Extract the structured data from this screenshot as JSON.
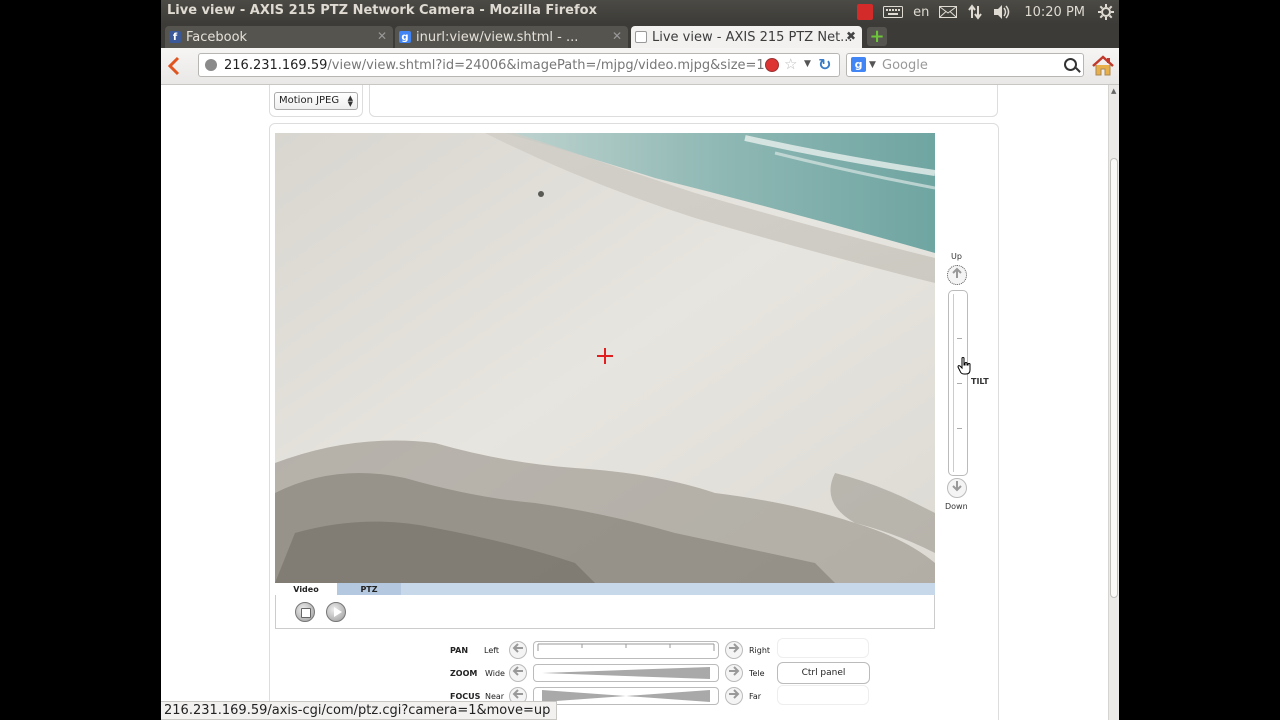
{
  "window": {
    "title": "Live view - AXIS 215 PTZ Network Camera - Mozilla Firefox"
  },
  "system_tray": {
    "keyboard_layout": "en",
    "clock": "10:20 PM"
  },
  "tabs": [
    {
      "label": "Facebook",
      "icon": "facebook-icon",
      "active": false
    },
    {
      "label": "inurl:view/view.shtml - ...",
      "icon": "google-icon",
      "active": false
    },
    {
      "label": "Live view - AXIS 215 PTZ Net...",
      "icon": "page-icon",
      "active": true
    }
  ],
  "navigation": {
    "url_host": "216.231.169.59",
    "url_path": "/view/view.shtml?id=24006&imagePath=/mjpg/video.mjpg&size=1",
    "search_placeholder": "Google"
  },
  "stream_format": {
    "selected": "Motion JPEG"
  },
  "view_tabs": [
    {
      "label": "Video",
      "active": true
    },
    {
      "label": "PTZ",
      "active": false
    }
  ],
  "tilt": {
    "up_label": "Up",
    "down_label": "Down",
    "axis_label": "TILT"
  },
  "ptz_rows": [
    {
      "name": "PAN",
      "left": "Left",
      "right": "Right"
    },
    {
      "name": "ZOOM",
      "left": "Wide",
      "right": "Tele"
    },
    {
      "name": "FOCUS",
      "left": "Near",
      "right": "Far"
    }
  ],
  "ctrl_panel_label": "Ctrl panel",
  "status_bar": "216.231.169.59/axis-cgi/com/ptz.cgi?camera=1&move=up",
  "colors": {
    "crosshair": "#e02020",
    "tab_bar_active": "#c7d8ea",
    "ubuntu_panel": "#3c3b37"
  }
}
